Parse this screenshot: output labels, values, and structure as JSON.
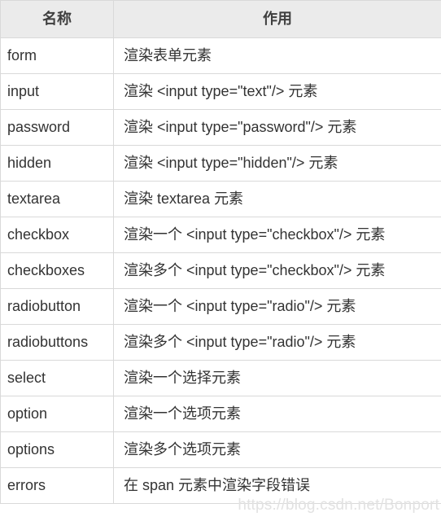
{
  "table": {
    "columns": [
      {
        "key": "name",
        "header": "名称"
      },
      {
        "key": "desc",
        "header": "作用"
      }
    ],
    "rows": [
      {
        "name": "form",
        "desc": "渲染表单元素"
      },
      {
        "name": "input",
        "desc": "渲染 <input type=\"text\"/> 元素"
      },
      {
        "name": "password",
        "desc": "渲染 <input type=\"password\"/> 元素"
      },
      {
        "name": "hidden",
        "desc": "渲染 <input type=\"hidden\"/> 元素"
      },
      {
        "name": "textarea",
        "desc": "渲染 textarea 元素"
      },
      {
        "name": "checkbox",
        "desc": "渲染一个 <input type=\"checkbox\"/> 元素"
      },
      {
        "name": "checkboxes",
        "desc": "渲染多个 <input type=\"checkbox\"/> 元素"
      },
      {
        "name": "radiobutton",
        "desc": "渲染一个 <input type=\"radio\"/> 元素"
      },
      {
        "name": "radiobuttons",
        "desc": "渲染多个 <input type=\"radio\"/> 元素"
      },
      {
        "name": "select",
        "desc": "渲染一个选择元素"
      },
      {
        "name": "option",
        "desc": "渲染一个选项元素"
      },
      {
        "name": "options",
        "desc": "渲染多个选项元素"
      },
      {
        "name": "errors",
        "desc": "在 span 元素中渲染字段错误"
      }
    ]
  },
  "watermark": {
    "text": "https://blog.csdn.net/Bonport"
  },
  "colors": {
    "header_background": "#ebebeb",
    "border": "#d9d9d9",
    "text": "#333333",
    "watermark": "#e2e2e2"
  }
}
